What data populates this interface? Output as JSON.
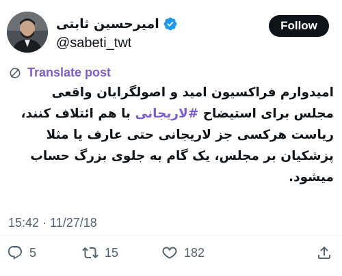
{
  "profile": {
    "display_name": "امیرحسین ثابتی",
    "handle": "@sabeti_twt",
    "verified": true,
    "verified_color": "#1d9bf0"
  },
  "follow_button": {
    "label": "Follow"
  },
  "translate": {
    "label": "Translate post",
    "color": "#7c5cd6"
  },
  "tweet": {
    "text_before": "امیدوارم فراکسیون امید و اصولگرایان واقعی مجلس برای استیضاح ",
    "hashtag": "#لاریجانی",
    "text_after": " با هم ائتلاف کنند، ریاست هرکسی جز لاریجانی حتی عارف یا مثلا پزشکیان بر مجلس، یک گام به جلوی بزرگ حساب میشود."
  },
  "meta": {
    "timestamp": "15:42 · 11/27/18"
  },
  "actions": {
    "reply": {
      "icon": "reply-icon",
      "count": "5"
    },
    "repost": {
      "icon": "repost-icon",
      "count": "15"
    },
    "like": {
      "icon": "heart-icon",
      "count": "182"
    },
    "share": {
      "icon": "share-icon"
    }
  }
}
